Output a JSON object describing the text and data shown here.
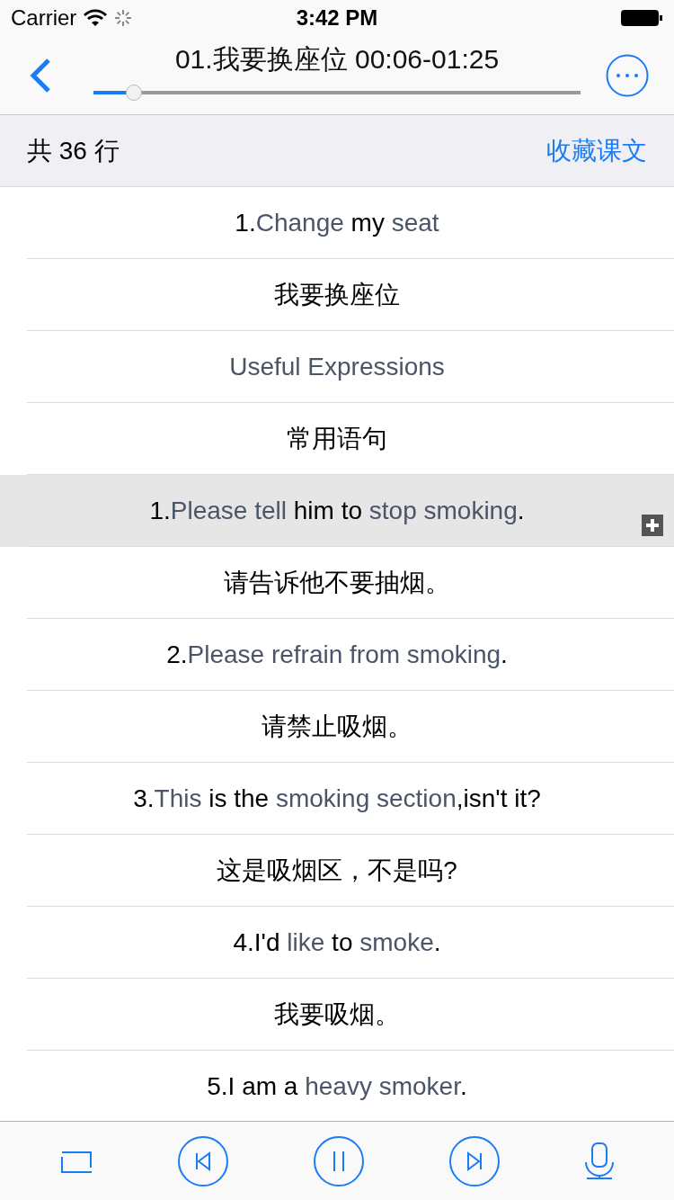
{
  "status_bar": {
    "carrier": "Carrier",
    "time": "3:42 PM"
  },
  "nav": {
    "title": "01.我要换座位 00:06-01:25",
    "progress": {
      "level": 0.083
    }
  },
  "header": {
    "count": "共 36 行",
    "action": "收藏课文"
  },
  "lines": [
    {
      "kind": "en",
      "selected": false,
      "parts": [
        {
          "text": "1.",
          "highlighted": false
        },
        {
          "text": "Change",
          "highlighted": true
        },
        {
          "text": " my ",
          "highlighted": false
        },
        {
          "text": "seat",
          "highlighted": true
        }
      ]
    },
    {
      "kind": "zh",
      "selected": false,
      "text": "我要换座位"
    },
    {
      "kind": "en",
      "selected": false,
      "parts": [
        {
          "text": "Useful Expressions",
          "highlighted": true
        }
      ]
    },
    {
      "kind": "zh",
      "selected": false,
      "text": "常用语句"
    },
    {
      "kind": "en",
      "selected": true,
      "parts": [
        {
          "text": "1.",
          "highlighted": false
        },
        {
          "text": "Please tell",
          "highlighted": true
        },
        {
          "text": " him to ",
          "highlighted": false
        },
        {
          "text": "stop smoking",
          "highlighted": true
        },
        {
          "text": ".",
          "highlighted": false
        }
      ]
    },
    {
      "kind": "zh",
      "selected": false,
      "text": "请告诉他不要抽烟。"
    },
    {
      "kind": "en",
      "selected": false,
      "parts": [
        {
          "text": "2.",
          "highlighted": false
        },
        {
          "text": "Please refrain from smoking",
          "highlighted": true
        },
        {
          "text": ".",
          "highlighted": false
        }
      ]
    },
    {
      "kind": "zh",
      "selected": false,
      "text": "请禁止吸烟。"
    },
    {
      "kind": "en",
      "selected": false,
      "parts": [
        {
          "text": "3.",
          "highlighted": false
        },
        {
          "text": "This",
          "highlighted": true
        },
        {
          "text": " is the ",
          "highlighted": false
        },
        {
          "text": "smoking section",
          "highlighted": true
        },
        {
          "text": ",isn't it?",
          "highlighted": false
        }
      ]
    },
    {
      "kind": "zh",
      "selected": false,
      "text": "这是吸烟区，不是吗?"
    },
    {
      "kind": "en",
      "selected": false,
      "parts": [
        {
          "text": "4.I'd ",
          "highlighted": false
        },
        {
          "text": "like",
          "highlighted": true
        },
        {
          "text": " to ",
          "highlighted": false
        },
        {
          "text": "smoke",
          "highlighted": true
        },
        {
          "text": ".",
          "highlighted": false
        }
      ]
    },
    {
      "kind": "zh",
      "selected": false,
      "text": "我要吸烟。"
    },
    {
      "kind": "en",
      "selected": false,
      "parts": [
        {
          "text": "5.I am a ",
          "highlighted": false
        },
        {
          "text": "heavy smoker",
          "highlighted": true
        },
        {
          "text": ".",
          "highlighted": false
        }
      ]
    }
  ]
}
